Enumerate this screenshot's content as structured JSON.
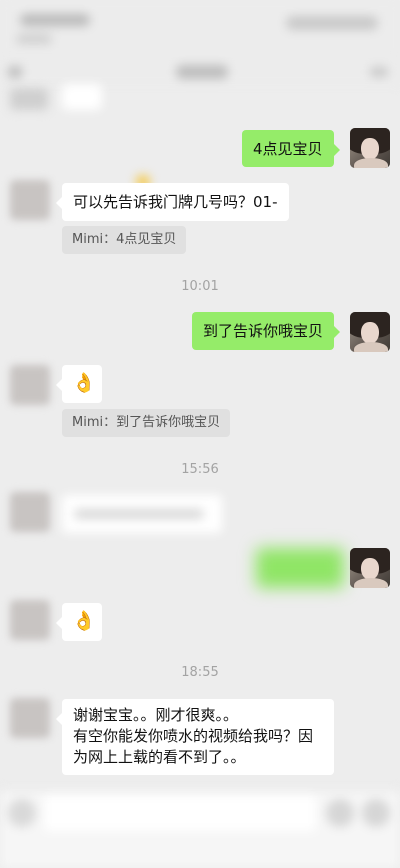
{
  "messages": {
    "m1": {
      "text": "4点见宝贝",
      "sender": "self"
    },
    "m2": {
      "text": "可以先告诉我门牌几号吗？01-",
      "sender": "other"
    },
    "m2_quote": {
      "text": "Mimi：4点见宝贝"
    },
    "t1": {
      "text": "10:01"
    },
    "m3": {
      "text": "到了告诉你哦宝贝",
      "sender": "self"
    },
    "m4": {
      "emoji": "👌",
      "sender": "other"
    },
    "m4_quote": {
      "text": "Mimi：到了告诉你哦宝贝"
    },
    "t2": {
      "text": "15:56"
    },
    "m5": {
      "text": "",
      "sender": "other",
      "blurred": true
    },
    "m6": {
      "text": "",
      "sender": "self",
      "blurred": true
    },
    "m7": {
      "emoji": "👌",
      "sender": "other"
    },
    "t3": {
      "text": "18:55"
    },
    "m8": {
      "line1": "谢谢宝宝。。刚才很爽。。",
      "line2": "有空你能发你喷水的视频给我吗？因",
      "line3": "为网上上载的看不到了。。",
      "sender": "other"
    }
  },
  "colors": {
    "background": "#ededed",
    "self_bubble": "#95ec69",
    "other_bubble": "#ffffff",
    "quote_bg": "#e0e0e0",
    "timestamp": "#a3a3a3"
  },
  "icons": {
    "ok_hand": "ok-hand-emoji",
    "back": "chevron-left-icon",
    "more": "more-icon",
    "voice": "voice-icon",
    "emoji_btn": "smile-icon",
    "plus": "plus-icon"
  }
}
